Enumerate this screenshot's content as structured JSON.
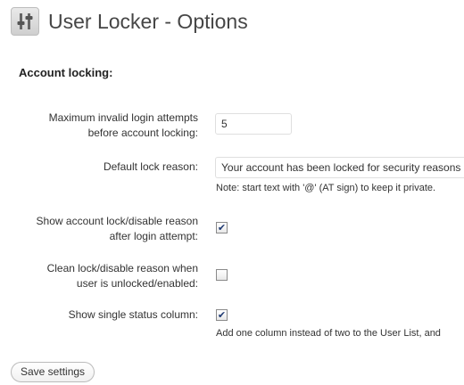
{
  "header": {
    "title": "User Locker - Options",
    "icon": "settings-sliders-icon"
  },
  "section": {
    "title": "Account locking:"
  },
  "max_attempts": {
    "label_line1": "Maximum invalid login attempts",
    "label_line2": "before account locking:",
    "value": "5"
  },
  "lock_reason": {
    "label": "Default lock reason:",
    "value": "Your account has been locked for security reasons",
    "note": "Note: start text with '@' (AT sign) to keep it private."
  },
  "show_reason": {
    "label_line1": "Show account lock/disable reason",
    "label_line2": "after login attempt:",
    "checked": true
  },
  "clean_reason": {
    "label_line1": "Clean lock/disable reason when",
    "label_line2": "user is unlocked/enabled:",
    "checked": false
  },
  "single_column": {
    "label": "Show single status column:",
    "checked": true,
    "note": "Add one column instead of two to the User List, and"
  },
  "actions": {
    "save_label": "Save settings"
  },
  "check_glyph": "✔"
}
